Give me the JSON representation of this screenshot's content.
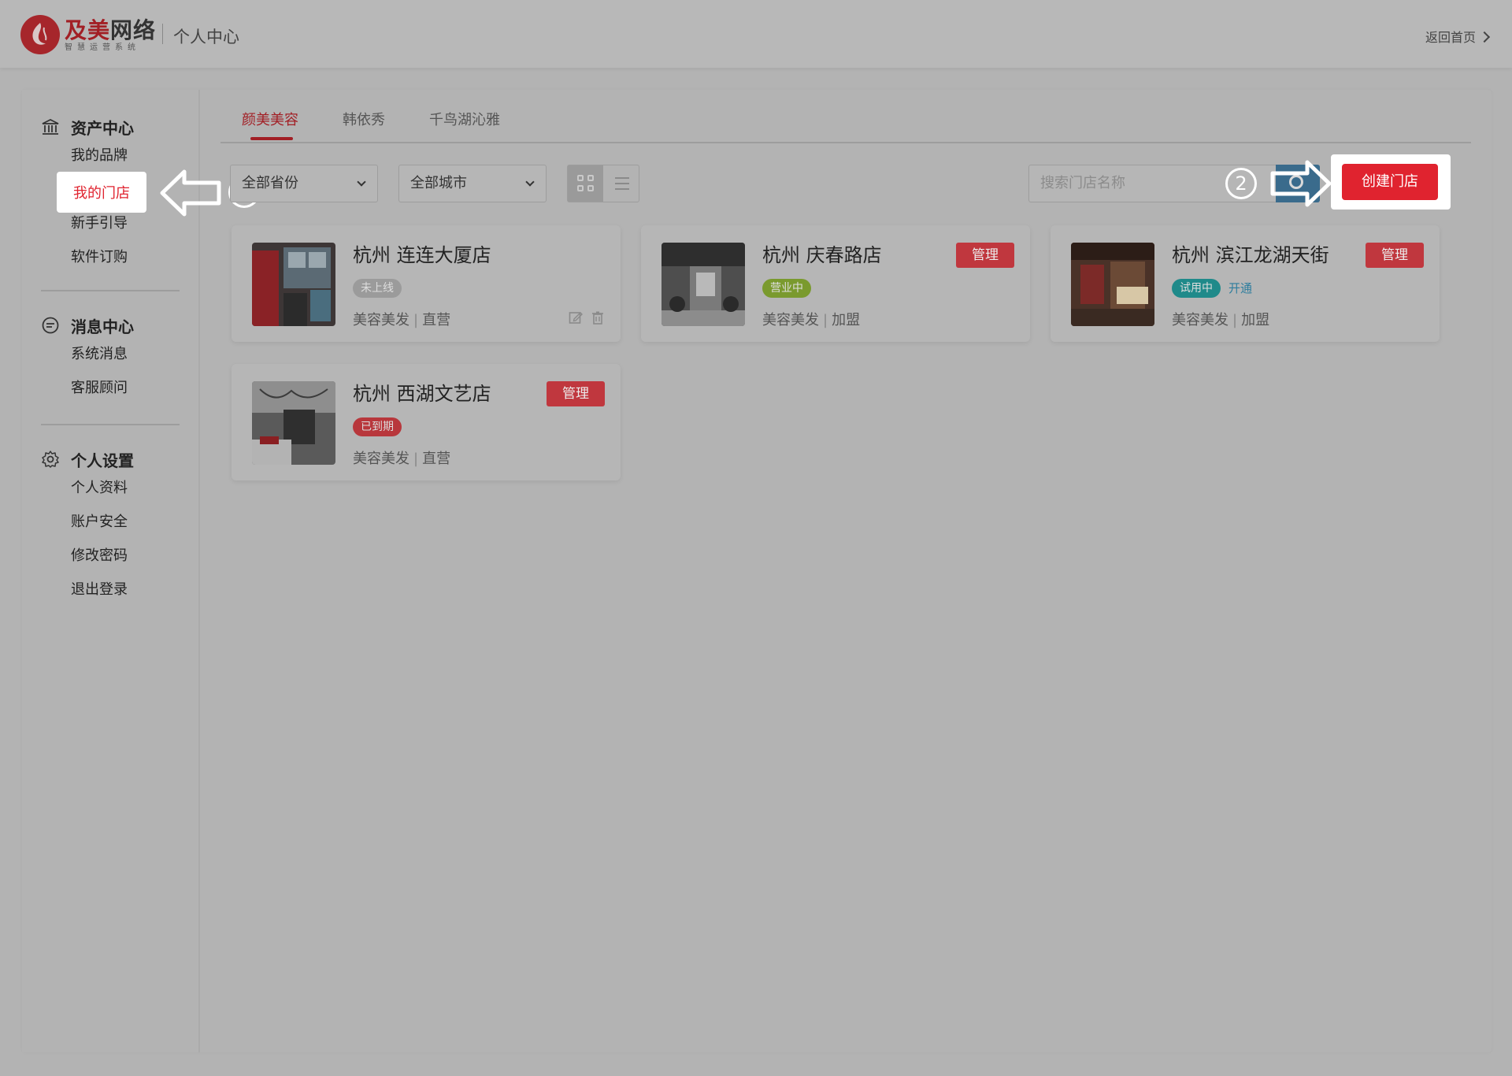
{
  "header": {
    "brand_main": "及美",
    "brand_dark": "网络",
    "brand_sub": "智慧运营系统",
    "title": "个人中心",
    "back_label": "返回首页"
  },
  "sidebar": {
    "groups": [
      {
        "title": "资产中心",
        "icon": "bank-icon",
        "items": [
          "我的品牌",
          "我的门店",
          "新手引导",
          "软件订购"
        ]
      },
      {
        "title": "消息中心",
        "icon": "message-icon",
        "items": [
          "系统消息",
          "客服顾问"
        ]
      },
      {
        "title": "个人设置",
        "icon": "gear-icon",
        "items": [
          "个人资料",
          "账户安全",
          "修改密码",
          "退出登录"
        ]
      }
    ],
    "selected_item": "我的门店"
  },
  "tabs": [
    "颜美美容",
    "韩依秀",
    "千鸟湖沁雅"
  ],
  "active_tab": "颜美美容",
  "filters": {
    "province": "全部省份",
    "city": "全部城市",
    "search_placeholder": "搜索门店名称",
    "create_label": "创建门店"
  },
  "annotations": {
    "step1": "1",
    "step2": "2"
  },
  "stores": [
    {
      "city": "杭州",
      "name": "连连大厦店",
      "status": "未上线",
      "status_color": "#9b9b9b",
      "category": "美容美发",
      "type": "直营",
      "manage": "",
      "open_link": ""
    },
    {
      "city": "杭州",
      "name": "庆春路店",
      "status": "营业中",
      "status_color": "#7a9a2e",
      "category": "美容美发",
      "type": "加盟",
      "manage": "管理",
      "open_link": ""
    },
    {
      "city": "杭州",
      "name": "滨江龙湖天街",
      "status": "试用中",
      "status_color": "#1f8a8a",
      "category": "美容美发",
      "type": "加盟",
      "manage": "管理",
      "open_link": "开通"
    },
    {
      "city": "杭州",
      "name": "西湖文艺店",
      "status": "已到期",
      "status_color": "#b8373c",
      "category": "美容美发",
      "type": "直营",
      "manage": "管理",
      "open_link": ""
    }
  ],
  "colors": {
    "accent": "#e0232f",
    "brand": "#a21f25"
  }
}
